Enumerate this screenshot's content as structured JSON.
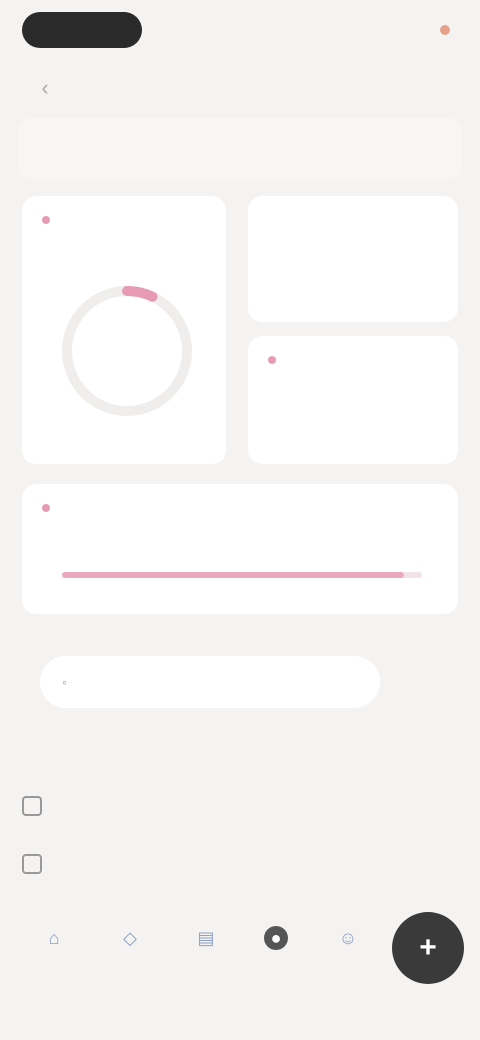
{
  "status_bar": {
    "time": "",
    "battery_text": "",
    "battery_color": "#e6a08a"
  },
  "nav": {
    "back_icon": "chevron-left-icon",
    "title": "",
    "action": ""
  },
  "hero": {
    "text": "",
    "meta": ""
  },
  "cards": {
    "ring": {
      "label": "",
      "value": "",
      "progress": 0.07,
      "accent": "#e79ab4"
    },
    "small1": {
      "label": "",
      "value": ""
    },
    "small2": {
      "label": "",
      "value": ""
    }
  },
  "progress": {
    "label": "",
    "meta": "",
    "value": "",
    "fraction": 0.95,
    "accent": "#eaa8c1"
  },
  "pill": {
    "label": "",
    "meta": ""
  },
  "section": {
    "heading": ""
  },
  "list": [
    {
      "icon": "checkbox-icon",
      "label": ""
    },
    {
      "icon": "checkbox-icon",
      "label": ""
    }
  ],
  "bottom_nav": {
    "tabs": [
      {
        "icon": "home-icon",
        "label": ""
      },
      {
        "icon": "compass-icon",
        "label": ""
      },
      {
        "icon": "chart-icon",
        "label": ""
      },
      {
        "icon": "circle-icon",
        "label": ""
      },
      {
        "icon": "user-icon",
        "label": ""
      }
    ],
    "active_index": 3
  },
  "fab": {
    "icon": "plus-icon",
    "label": "+"
  }
}
